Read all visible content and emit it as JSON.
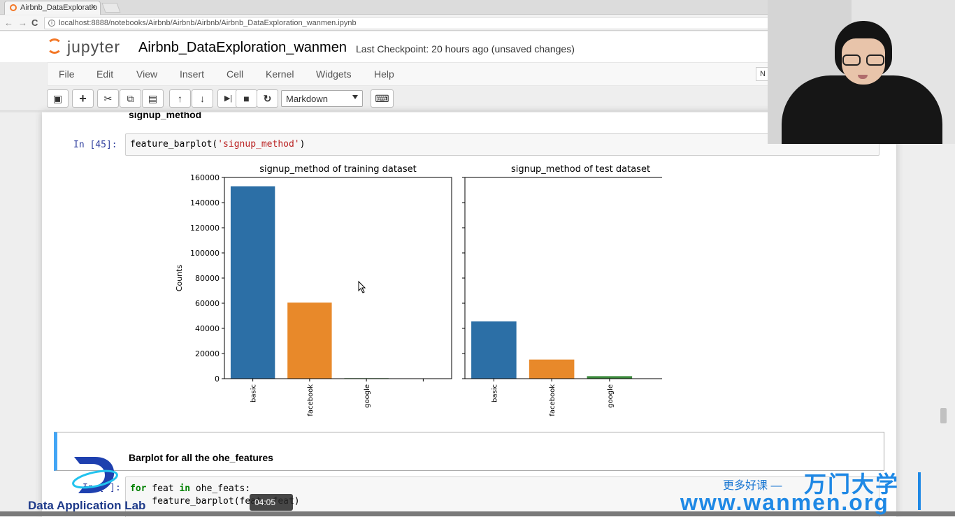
{
  "browser": {
    "tab_title": "Airbnb_DataExploratio",
    "tab_close": "×",
    "url": "localhost:8888/notebooks/Airbnb/Airbnb/Airbnb/Airbnb_DataExploration_wanmen.ipynb",
    "back": "←",
    "forward": "→",
    "reload": "C",
    "info_icon": "i"
  },
  "jupyter": {
    "logo_text": "jupyter",
    "notebook_title": "Airbnb_DataExploration_wanmen",
    "checkpoint": "Last Checkpoint: 20 hours ago (unsaved changes)",
    "menu": [
      "File",
      "Edit",
      "View",
      "Insert",
      "Cell",
      "Kernel",
      "Widgets",
      "Help"
    ],
    "kernel_indicator": "N",
    "cell_type": "Markdown",
    "toolbar_icons": [
      "save-icon",
      "plus-icon",
      "scissors-icon",
      "copy-icon",
      "paste-icon",
      "arrow-up-icon",
      "arrow-down-icon",
      "run-icon",
      "stop-icon",
      "restart-icon",
      "keyboard-icon"
    ],
    "toolbar_glyphs": [
      "▣",
      "+",
      "✂",
      "⧉",
      "▤",
      "↑",
      "↓",
      "▶|",
      "■",
      "↻",
      "⌨"
    ]
  },
  "cells": {
    "heading1": "signup_method",
    "prompt1": "In  [45]:",
    "code1_fn": "feature_barplot(",
    "code1_arg": "'signup_method'",
    "code1_end": ")",
    "heading2": "Barplot for all the ohe_features",
    "prompt2": "In [ ]:",
    "code2_line1_kw1": "for",
    "code2_line1_mid": " feat ",
    "code2_line1_kw2": "in",
    "code2_line1_end": " ohe_feats:",
    "code2_line2": "    feature_barplot(feat, feat)"
  },
  "chart_data": [
    {
      "type": "bar",
      "title": "signup_method of training dataset",
      "ylabel": "Counts",
      "xlabel": "",
      "categories": [
        "basic",
        "facebook",
        "google"
      ],
      "values": [
        153000,
        60500,
        400
      ],
      "colors": [
        "#2c6fa6",
        "#e8892a",
        "#3b8a3b"
      ],
      "ylim": [
        0,
        160000
      ],
      "yticks": [
        "0",
        "20000",
        "40000",
        "60000",
        "80000",
        "100000",
        "120000",
        "140000",
        "160000"
      ],
      "grid": false
    },
    {
      "type": "bar",
      "title": "signup_method of test dataset",
      "ylabel": "",
      "xlabel": "",
      "categories": [
        "basic",
        "facebook",
        "google"
      ],
      "values": [
        45500,
        15200,
        2000
      ],
      "colors": [
        "#2c6fa6",
        "#e8892a",
        "#3b8a3b"
      ],
      "ylim": [
        0,
        160000
      ],
      "grid": false
    }
  ],
  "overlay": {
    "video_time": "04:05",
    "logo_text": "Data Application Lab",
    "slogan": "更多好课 —",
    "brand": "万门大学",
    "site": "www.wanmen.org"
  }
}
